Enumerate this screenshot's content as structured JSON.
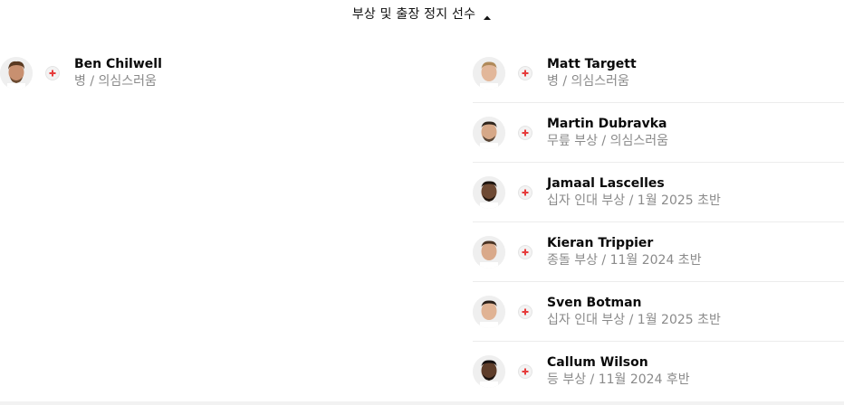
{
  "header": {
    "title": "부상 및 출장 정지 선수",
    "toggle_icon": "caret-up-icon"
  },
  "colors": {
    "injury_cross": "#e63b3b",
    "status_text": "#8a8a8a",
    "name_text": "#0a0a0a"
  },
  "left_column": [
    {
      "name": "Ben Chilwell",
      "status": "병 / 의심스러움",
      "status_icon": "injury-cross-icon"
    }
  ],
  "right_column": [
    {
      "name": "Matt Targett",
      "status": "병 / 의심스러움",
      "status_icon": "injury-cross-icon"
    },
    {
      "name": "Martin Dubravka",
      "status": "무릎 부상 / 의심스러움",
      "status_icon": "injury-cross-icon"
    },
    {
      "name": "Jamaal Lascelles",
      "status": "십자 인대 부상 / 1월 2025 초반",
      "status_icon": "injury-cross-icon"
    },
    {
      "name": "Kieran Trippier",
      "status": "종돌 부상 / 11월 2024 초반",
      "status_icon": "injury-cross-icon"
    },
    {
      "name": "Sven Botman",
      "status": "십자 인대 부상 / 1월 2025 초반",
      "status_icon": "injury-cross-icon"
    },
    {
      "name": "Callum Wilson",
      "status": "등 부상 / 11월 2024 후반",
      "status_icon": "injury-cross-icon"
    }
  ]
}
